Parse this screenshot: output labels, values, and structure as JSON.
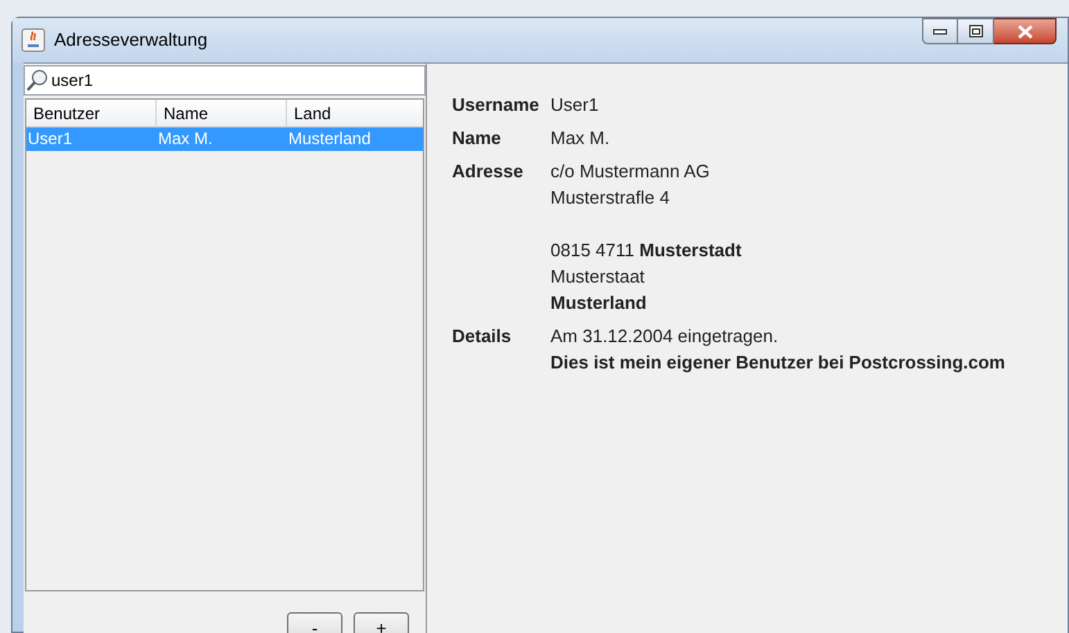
{
  "window": {
    "title": "Adresseverwaltung"
  },
  "search": {
    "value": "user1"
  },
  "table": {
    "columns": [
      "Benutzer",
      "Name",
      "Land"
    ],
    "rows": [
      {
        "cells": [
          "User1",
          "Max M.",
          "Musterland"
        ],
        "selected": true
      }
    ]
  },
  "buttons": [
    "-",
    "+"
  ],
  "details": [
    {
      "label": "Username",
      "blocks": [
        [
          {
            "text": "User1",
            "bold": false
          }
        ]
      ]
    },
    {
      "label": "Name",
      "blocks": [
        [
          {
            "text": "Max M.",
            "bold": false
          }
        ]
      ]
    },
    {
      "label": "Adresse",
      "blocks": [
        [
          {
            "text": "c/o Mustermann AG",
            "bold": false
          },
          {
            "text": "Musterstrafle 4",
            "bold": false
          }
        ],
        [
          {
            "text": "0815 4711 **Musterstadt**",
            "bold": false
          },
          {
            "text": "Musterstaat",
            "bold": false
          },
          {
            "text": "Musterland",
            "bold": true
          }
        ]
      ]
    },
    {
      "label": "Details",
      "blocks": [
        [
          {
            "text": "Am 31.12.2004 eingetragen.",
            "bold": false
          },
          {
            "text": "Dies ist mein eigener Benutzer bei Postcrossing.com",
            "bold": true
          }
        ]
      ]
    }
  ]
}
